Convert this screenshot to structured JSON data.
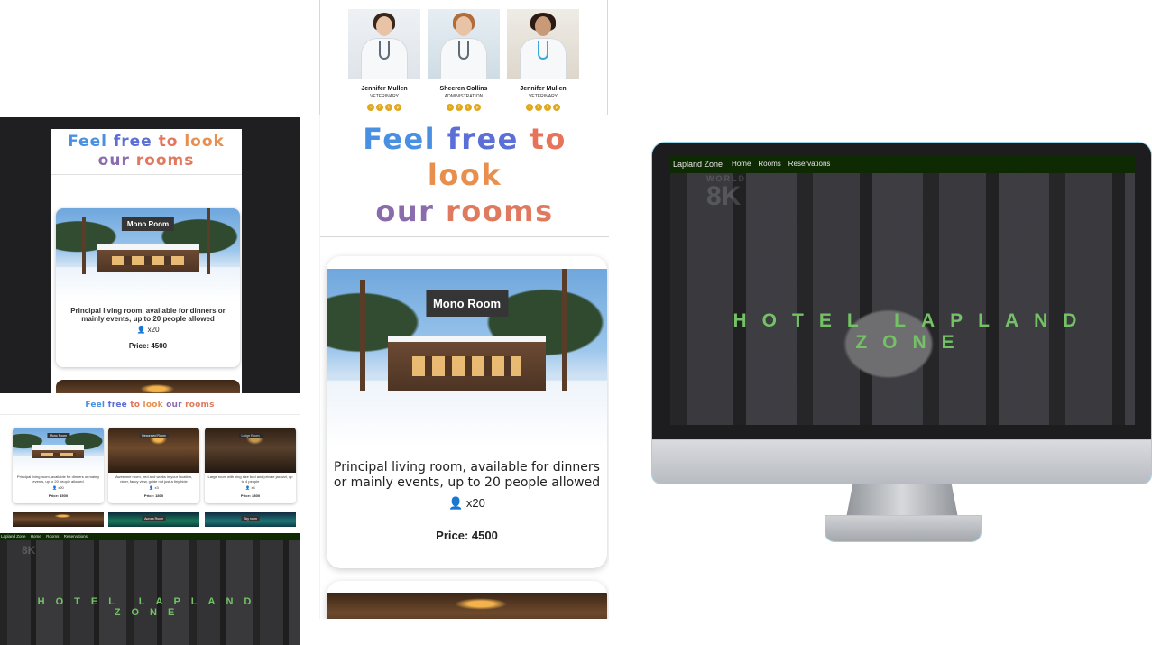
{
  "team": {
    "members": [
      {
        "name": "Jennifer Mullen",
        "role": "VETERINARY"
      },
      {
        "name": "Sheeren Collins",
        "role": "ADMINISTRATION"
      },
      {
        "name": "Jennifer Mullen",
        "role": "VETERINARY"
      }
    ]
  },
  "rooms_section": {
    "title_words": [
      "Feel",
      "free",
      "to",
      "look",
      "our",
      "rooms"
    ],
    "title_full": "Feel free to look our rooms"
  },
  "room_card": {
    "name": "Mono Room",
    "description": "Principal living room, available for dinners or mainly events, up to 20 people allowed",
    "capacity": "x20",
    "price": "Price: 4500"
  },
  "grid_cards": [
    {
      "name": "Mono Room",
      "description": "Principal living room, available for dinners or mainly events, up to 20 people allowed",
      "capacity": "x20",
      "price": "Price: 4500"
    },
    {
      "name": "Decorated Room",
      "description": "Awesome room, bed and works in your location, nicer, fancy view, guide not just a tiny hide",
      "capacity": "x3",
      "price": "Price: 1800"
    },
    {
      "name": "Lodge Room",
      "description": "Large room with king size bed and private jacuzzi, up to 4 people",
      "capacity": "x4",
      "price": "Price: 3800"
    }
  ],
  "grid_row2": [
    {
      "name": ""
    },
    {
      "name": "Aurora Room"
    },
    {
      "name": "Sky room"
    }
  ],
  "hero": {
    "brand": "Lapland Zone",
    "nav": [
      "Home",
      "Rooms",
      "Reservations"
    ],
    "logo_top": "WORLD",
    "logo_main": "8K",
    "title": "HOTEL LAPLAND ZONE"
  },
  "colors": {
    "nav_bg": "#0e2a02",
    "hero_title": "#74c265",
    "social_icon": "#e0a81f"
  },
  "icons": {
    "capacity": "person-icon",
    "socials": [
      "instagram-icon",
      "facebook-icon",
      "twitter-icon",
      "pinterest-icon"
    ]
  }
}
